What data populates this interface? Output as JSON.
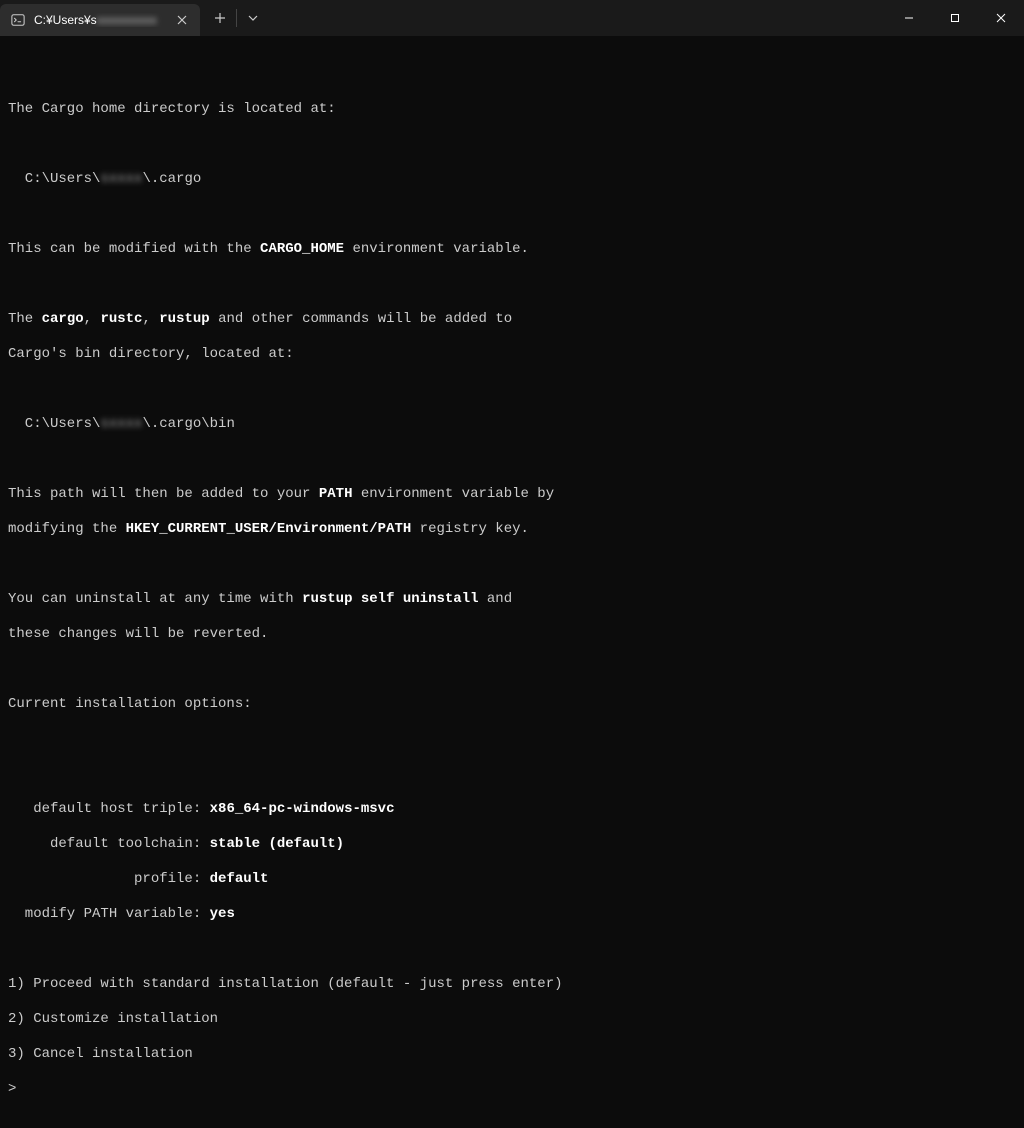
{
  "titlebar": {
    "tab_title_prefix": "C:¥Users¥s",
    "tab_title_blurred": "xxxxxxxxxx"
  },
  "t": {
    "l1": "The Cargo home directory is located at:",
    "l2a": "  C:\\Users\\",
    "l2b": "sxxxx",
    "l2c": "\\.cargo",
    "l3a": "This can be modified with the ",
    "l3b": "CARGO_HOME",
    "l3c": " environment variable.",
    "l4a": "The ",
    "l4b": "cargo",
    "l4c": ", ",
    "l4d": "rustc",
    "l4e": ", ",
    "l4f": "rustup",
    "l4g": " and other commands will be added to",
    "l5": "Cargo's bin directory, located at:",
    "l6a": "  C:\\Users\\",
    "l6b": "sxxxx",
    "l6c": "\\.cargo\\bin",
    "l7a": "This path will then be added to your ",
    "l7b": "PATH",
    "l7c": " environment variable by",
    "l8a": "modifying the ",
    "l8b": "HKEY_CURRENT_USER/Environment/PATH",
    "l8c": " registry key.",
    "l9a": "You can uninstall at any time with ",
    "l9b": "rustup self uninstall",
    "l9c": " and",
    "l10": "these changes will be reverted.",
    "l11": "Current installation options:",
    "opt1k": "   default host triple: ",
    "opt1v": "x86_64-pc-windows-msvc",
    "opt2k": "     default toolchain: ",
    "opt2v": "stable (default)",
    "opt3k": "               profile: ",
    "opt3v": "default",
    "opt4k": "  modify PATH variable: ",
    "opt4v": "yes",
    "choice1": "1) Proceed with standard installation (default - just press enter)",
    "choice2": "2) Customize installation",
    "choice3": "3) Cancel installation",
    "prompt": ">"
  }
}
